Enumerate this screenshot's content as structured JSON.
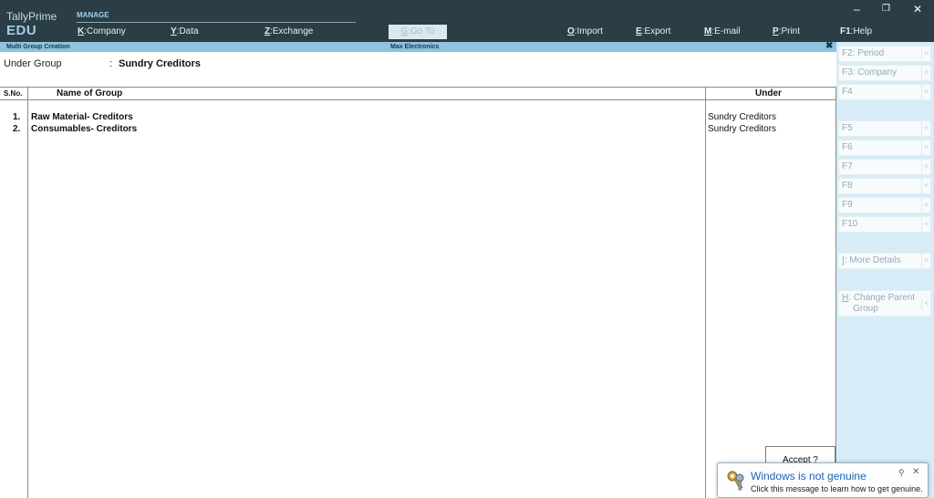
{
  "app": {
    "name": "TallyPrime",
    "edition": "EDU"
  },
  "menu": {
    "section": "MANAGE",
    "company": {
      "key": "K",
      "label": ":Company"
    },
    "data": {
      "key": "Y",
      "label": ":Data"
    },
    "exchange": {
      "key": "Z",
      "label": ":Exchange"
    },
    "goto": {
      "key": "G",
      "label": ":Go To"
    },
    "import": {
      "key": "O",
      "label": ":Import"
    },
    "export": {
      "key": "E",
      "label": ":Export"
    },
    "email": {
      "key": "M",
      "label": ":E-mail"
    },
    "print": {
      "key": "P",
      "label": ":Print"
    },
    "help": {
      "key": "F1",
      "label": ":Help"
    }
  },
  "window_controls": {
    "minimize": "–",
    "restore": "❐",
    "close": "✕"
  },
  "screen": {
    "title": "Multi Group  Creation",
    "company": "Max Electronics",
    "close": "✖"
  },
  "form": {
    "under_label": "Under Group",
    "colon": ":",
    "under_value": "Sundry Creditors"
  },
  "table": {
    "headers": {
      "sno": "S.No.",
      "name": "Name of Group",
      "under": "Under"
    },
    "rows": [
      {
        "sno": "1.",
        "name": "Raw Material- Creditors",
        "under": "Sundry Creditors"
      },
      {
        "sno": "2.",
        "name": "Consumables- Creditors",
        "under": "Sundry Creditors"
      }
    ]
  },
  "side_buttons": {
    "f2": {
      "key": "F2",
      "label": ": Period"
    },
    "f3": {
      "key": "F3",
      "label": ": Company"
    },
    "f4": {
      "key": "F4",
      "label": ""
    },
    "f5": {
      "key": "F5",
      "label": ""
    },
    "f6": {
      "key": "F6",
      "label": ""
    },
    "f7": {
      "key": "F7",
      "label": ""
    },
    "f8": {
      "key": "F8",
      "label": ""
    },
    "f9": {
      "key": "F9",
      "label": ""
    },
    "f10": {
      "key": "F10",
      "label": ""
    },
    "more": {
      "key": "I",
      "label": ": More Details"
    },
    "parent": {
      "key": "H",
      "label": ": Change Parent",
      "label2": "Group"
    },
    "arrow": "<"
  },
  "accept": {
    "label": "Accept ?"
  },
  "notification": {
    "title": "Windows is not genuine",
    "body": "Click this message to learn how to get genuine.",
    "pin": "⚲",
    "close": "✕"
  },
  "colors": {
    "topbar": "#2b3d45",
    "strip": "#8fc3de",
    "panel": "#d7ecf7",
    "link": "#1e62b5"
  }
}
